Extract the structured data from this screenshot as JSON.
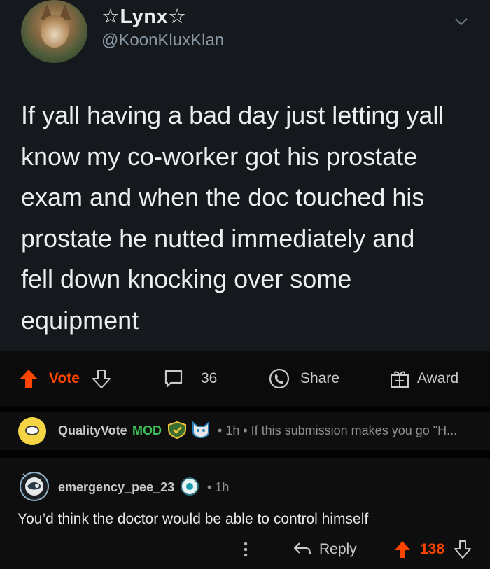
{
  "tweet": {
    "display_name": "☆Lynx☆",
    "handle": "@KoonKluxKlan",
    "text_lines": [
      "If yall having a bad day just letting yall",
      "know my co-worker got his prostate",
      "exam and when the doc touched his",
      "prostate he nutted immediately and",
      "fell down knocking over some",
      "equipment"
    ]
  },
  "post_actions": {
    "vote_label": "Vote",
    "comment_count": "36",
    "share_label": "Share",
    "award_label": "Award"
  },
  "mod_comment": {
    "username": "QualityVote",
    "mod_tag": "MOD",
    "meta": "• 1h • If this submission makes you go \"H..."
  },
  "reply_comment": {
    "username": "emergency_pee_23",
    "age": "• 1h",
    "body": "You’d think the doctor would be able to control himself",
    "more_label": "⋮",
    "reply_label": "Reply",
    "score": "138"
  },
  "colors": {
    "upvote": "#ff4500",
    "mod_green": "#3fbf5a",
    "tweet_bg": "#15181d",
    "page_bg": "#0e0e0e"
  }
}
